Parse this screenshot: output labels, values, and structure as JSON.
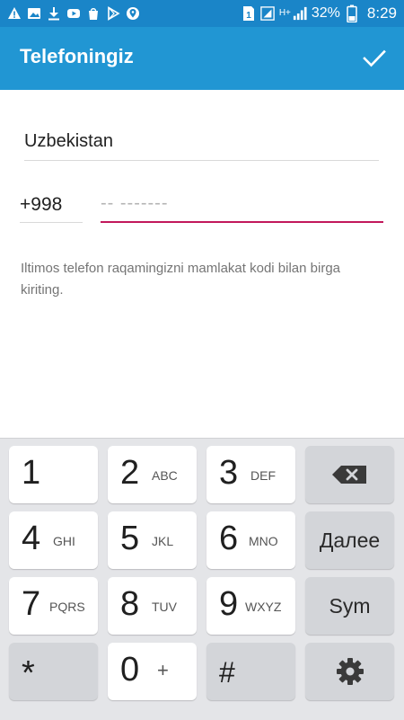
{
  "status_bar": {
    "battery_percent": "32%",
    "network_label": "H+",
    "time": "8:29",
    "sim_label": "1"
  },
  "app_bar": {
    "title": "Telefoningiz",
    "confirm_icon": "check-icon"
  },
  "form": {
    "country": "Uzbekistan",
    "country_code": "+998",
    "phone_placeholder": "-- -------",
    "phone_value": "",
    "hint": "Iltimos telefon raqamingizni mamlakat kodi bilan birga kiriting."
  },
  "keyboard": {
    "keys": [
      {
        "main": "1",
        "sub": ""
      },
      {
        "main": "2",
        "sub": "ABC"
      },
      {
        "main": "3",
        "sub": "DEF"
      },
      {
        "main": "4",
        "sub": "GHI"
      },
      {
        "main": "5",
        "sub": "JKL"
      },
      {
        "main": "6",
        "sub": "MNO"
      },
      {
        "main": "7",
        "sub": "PQRS"
      },
      {
        "main": "8",
        "sub": "TUV"
      },
      {
        "main": "9",
        "sub": "WXYZ"
      },
      {
        "main": "*",
        "sub": ""
      },
      {
        "main": "0",
        "sub": "+"
      },
      {
        "main": "#",
        "sub": ""
      }
    ],
    "next_label": "Далее",
    "sym_label": "Sym",
    "backspace_icon": "backspace-icon",
    "settings_icon": "gear-icon"
  },
  "colors": {
    "status_bar": "#1A85C8",
    "app_bar": "#2196D3",
    "input_focus": "#C2185B"
  }
}
